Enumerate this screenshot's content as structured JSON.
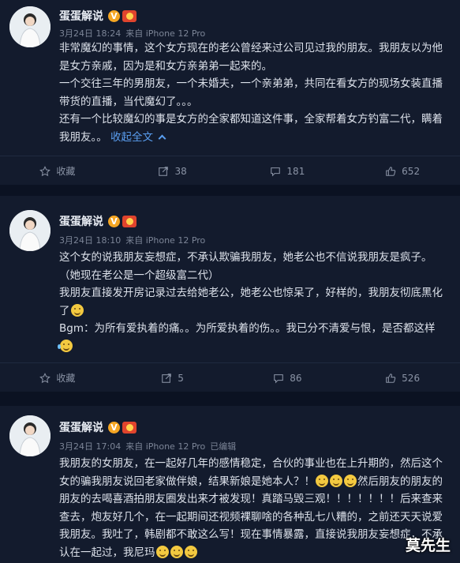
{
  "posts": [
    {
      "author": "蛋蛋解说",
      "verified": "V",
      "time": "3月24日 18:24",
      "source": "来自 iPhone 12 Pro",
      "edited": "",
      "paragraphs": [
        "非常魔幻的事情，这个女方现在的老公曾经来过公司见过我的朋友。我朋友以为他是女方亲戚，因为是和女方亲弟弟一起来的。",
        "一个交往三年的男朋友，一个未婚夫，一个亲弟弟，共同在看女方的现场女装直播带货的直播，当代魔幻了。。。",
        "还有一个比较魔幻的事是女方的全家都知道这件事，全家帮着女方钓富二代，瞒着我朋友。。"
      ],
      "collapse_label": "收起全文",
      "actions": {
        "favorite": "收藏",
        "repost": "38",
        "comment": "181",
        "like": "652"
      }
    },
    {
      "author": "蛋蛋解说",
      "verified": "V",
      "time": "3月24日 18:10",
      "source": "来自 iPhone 12 Pro",
      "edited": "",
      "p1": "这个女的说我朋友妄想症，不承认欺骗我朋友，她老公也不信说我朋友是疯子。（她现在老公是一个超级富二代）",
      "p2": "我朋友直接发开房记录过去给她老公，她老公也惊呆了，好样的，我朋友彻底黑化了",
      "p3": "Bgm：为所有爱执着的痛。。为所爱执着的伤。。我已分不清爱与恨，是否都这样",
      "actions": {
        "favorite": "收藏",
        "repost": "5",
        "comment": "86",
        "like": "526"
      }
    },
    {
      "author": "蛋蛋解说",
      "verified": "V",
      "time": "3月24日 17:04",
      "source": "来自 iPhone 12 Pro",
      "edited": "已编辑",
      "p1": "我朋友的女朋友，在一起好几年的感情稳定，合伙的事业也在上升期的，然后这个女的骗我朋友说回老家做伴娘，结果新娘是她本人？！",
      "p2": "然后朋友的朋友的朋友的去喝喜酒拍朋友圈发出来才被发现！真踏马毁三观！！！！！！！后来查来查去，炮友好几个，在一起期间还视频裸聊啥的各种乱七八糟的，之前还天天说爱我朋友。我吐了，韩剧都不敢这么写！现在事情暴露，直接说我朋友妄想症，不承认在一起过，我尼玛"
    }
  ],
  "watermark": "莫先生"
}
